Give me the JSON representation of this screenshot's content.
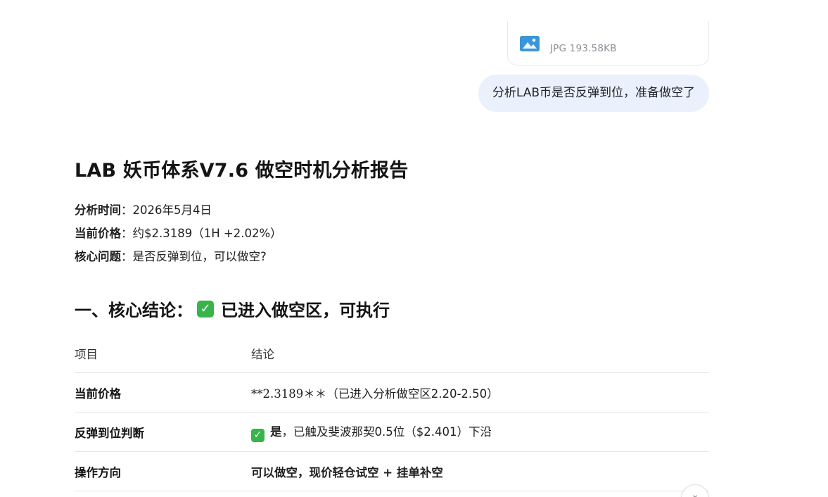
{
  "attachment": {
    "icon": "image-icon",
    "meta": "JPG 193.58KB"
  },
  "user_message": "分析LAB币是否反弹到位，准备做空了",
  "report": {
    "title": "LAB 妖币体系V7.6 做空时机分析报告",
    "meta": [
      {
        "label": "分析时间",
        "sep": "：",
        "value": "2026年5月4日"
      },
      {
        "label": "当前价格",
        "sep": "：",
        "value": "约$2.3189（1H +2.02%）"
      },
      {
        "label": "核心问题",
        "sep": "：",
        "value": "是否反弹到位，可以做空?"
      }
    ],
    "section": {
      "prefix": "一、核心结论：",
      "icon": "check-mark-icon",
      "check_glyph": "✓",
      "text": "已进入做空区，可执行"
    },
    "table": {
      "headers": [
        "项目",
        "结论"
      ],
      "rows": [
        {
          "item": "当前价格",
          "conclusion_main": "**2.3189＊＊",
          "conclusion_rest": "（已进入分析做空区2.20-2.50）"
        },
        {
          "item": "反弹到位判断",
          "check_glyph": "✓",
          "conclusion_bold": "是",
          "conclusion_rest": "，已触及斐波那契0.5位（$2.401）下沿"
        },
        {
          "item": "操作方向",
          "conclusion_bold": "可以做空，现价轻仓试空 + 挂单补空"
        }
      ]
    }
  },
  "scroll_button": {
    "glyph": "⌄",
    "icon": "chevron-down-icon"
  },
  "colors": {
    "user_bubble_bg": "#eaf1fc",
    "check_green": "#38b44a",
    "attachment_icon": "#3b96d9"
  }
}
